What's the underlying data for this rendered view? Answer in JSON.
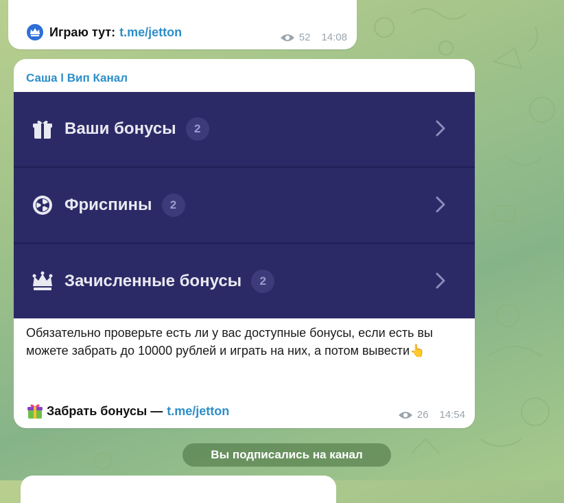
{
  "top_message": {
    "prefix_text": "Играю тут:",
    "link_text": "t.me/jetton",
    "views": "52",
    "time": "14:08",
    "icon": "crown-badge-icon"
  },
  "main_message": {
    "sender": "Саша l Вип Канал",
    "menu_items": [
      {
        "label": "Ваши бонусы",
        "count": "2",
        "icon": "gift-icon"
      },
      {
        "label": "Фриспины",
        "count": "2",
        "icon": "wheel-icon"
      },
      {
        "label": "Зачисленные бонусы",
        "count": "2",
        "icon": "crown-icon"
      }
    ],
    "body_text": "Обязательно проверьте есть ли у вас доступные бонусы, если есть вы можете забрать до 10000 рублей и играть на них, а потом вывести",
    "body_emoji": "👆",
    "footer_prefix": "Забрать бонусы —",
    "footer_link": "t.me/jetton",
    "views": "26",
    "time": "14:54"
  },
  "service_message": "Вы подписались на канал",
  "colors": {
    "link": "#2d8ec9",
    "menu_bg": "#2c2a66",
    "badge_bg": "#3d3b7a",
    "meta": "#9aa5ad"
  }
}
